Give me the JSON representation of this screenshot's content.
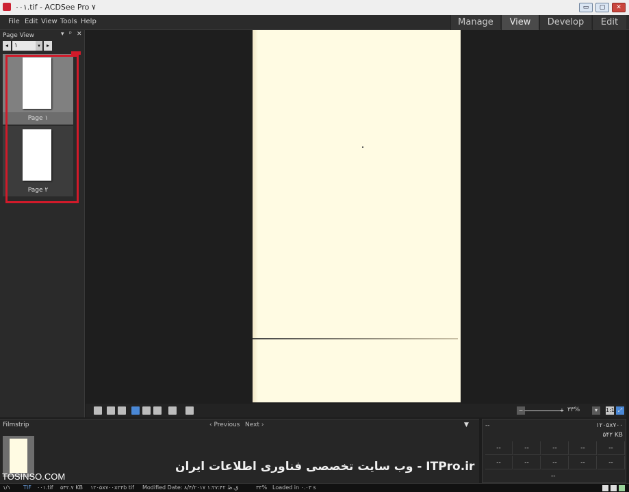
{
  "window": {
    "title": "۰۰۱.tif - ACDSee Pro ۷",
    "controls": [
      "▭",
      "▢",
      "✕"
    ]
  },
  "menu": [
    "File",
    "Edit",
    "View",
    "Tools",
    "Help"
  ],
  "modes": [
    {
      "label": "Manage",
      "active": false
    },
    {
      "label": "View",
      "active": true
    },
    {
      "label": "Develop",
      "active": false
    },
    {
      "label": "Edit",
      "active": false
    }
  ],
  "page_view": {
    "header": "Page View",
    "controls": {
      "dropdown": "▾",
      "pin": "ᵖ",
      "close": "✕"
    },
    "page_select": "۱",
    "prev": "◂",
    "next": "▸",
    "pages": [
      {
        "label": "Page ۱",
        "selected": true
      },
      {
        "label": "Page ۲",
        "selected": false
      }
    ]
  },
  "toolbar": {
    "zoom_minus": "−",
    "zoom_plus": "+",
    "zoom_value": "۳۳%",
    "zoom_dropdown": "▾"
  },
  "filmstrip": {
    "header": "Filmstrip",
    "previous": "‹ Previous",
    "next": "Next ›"
  },
  "info": {
    "top_left": "--",
    "line1": "۱۲۰۵x۷۰۰",
    "line2": "۵۴۲ KB",
    "cells": [
      "--",
      "--",
      "--",
      "--",
      "--",
      "--",
      "--",
      "--",
      "--",
      "--"
    ],
    "bottom": "--"
  },
  "watermark": {
    "site": "TOSINSO.COM",
    "banner": "ITPro.ir - وب سایت تخصصی فناوری اطلاعات ایران"
  },
  "status": {
    "index": "۱/۱",
    "format": "TIF",
    "file": "۰۰۱.tif",
    "size": "۵۴۲.۷ KB",
    "dims": "۱۲۰۵x۷۰۰x۲۴b tif",
    "modified": "Modified Date: ۸/۴/۲۰۱۷ ۱:۲۷:۴۲ ق.ظ",
    "zoom": "۳۳%",
    "loaded": "Loaded in ۰.۰۳ s"
  }
}
